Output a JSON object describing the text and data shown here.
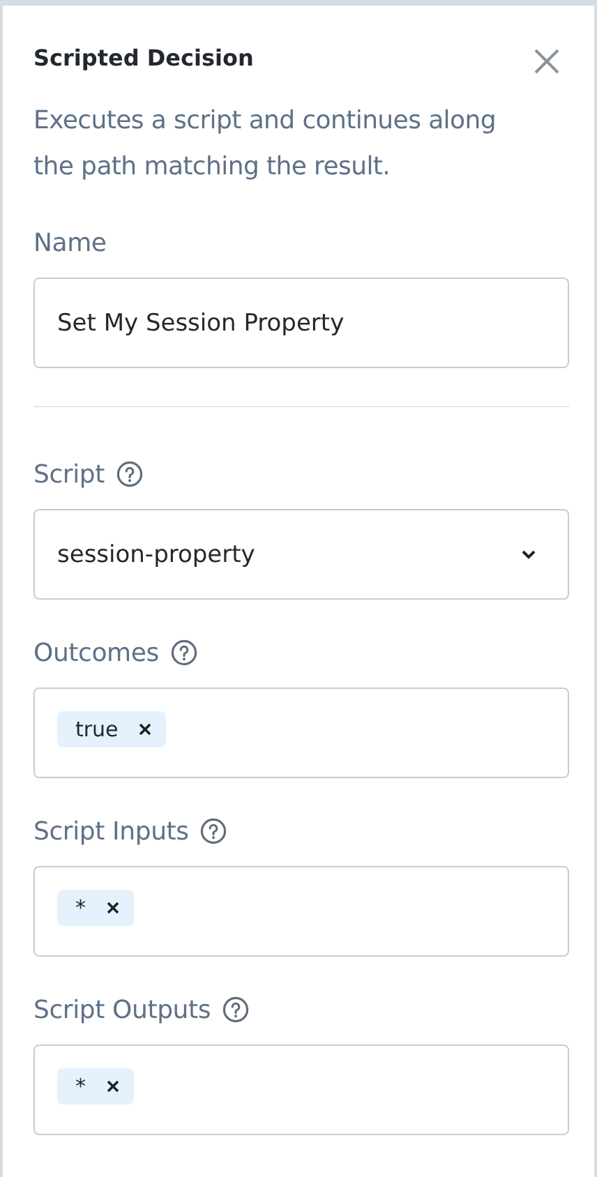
{
  "panel": {
    "title": "Scripted Decision",
    "description": "Executes a script and continues along the path matching the result."
  },
  "sections": [
    [
      {
        "kind": "text",
        "label": "Name",
        "help": false,
        "value": "Set My Session Property"
      }
    ],
    [
      {
        "kind": "select",
        "label": "Script",
        "help": true,
        "value": "session-property"
      },
      {
        "kind": "tags",
        "label": "Outcomes",
        "help": true,
        "tags": [
          "true"
        ]
      },
      {
        "kind": "tags",
        "label": "Script Inputs",
        "help": true,
        "tags": [
          "*"
        ]
      },
      {
        "kind": "tags",
        "label": "Script Outputs",
        "help": true,
        "tags": [
          "*"
        ]
      }
    ]
  ]
}
